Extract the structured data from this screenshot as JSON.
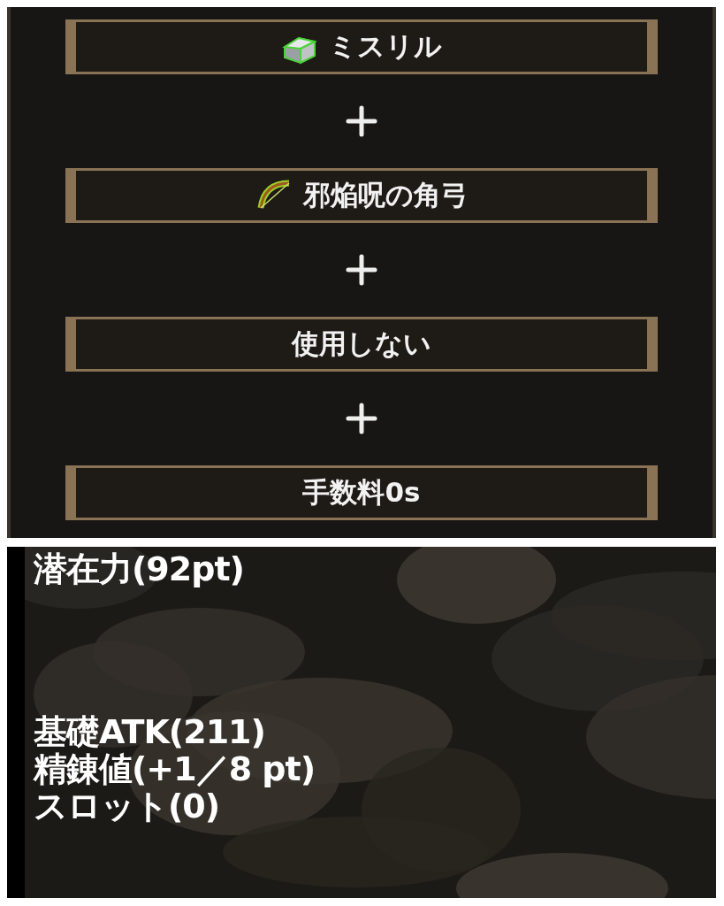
{
  "slots": [
    {
      "label": "ミスリル",
      "kind": "material"
    },
    {
      "label": "邪焔呪の角弓",
      "kind": "weapon"
    },
    {
      "label": "使用しない",
      "kind": "empty"
    },
    {
      "label": "手数料0s",
      "kind": "fee"
    }
  ],
  "stats": {
    "potential": "潜在力(92pt)",
    "lines": [
      "基礎ATK(211)",
      "精錬値(+1／8 pt)",
      "スロット(0)"
    ]
  }
}
